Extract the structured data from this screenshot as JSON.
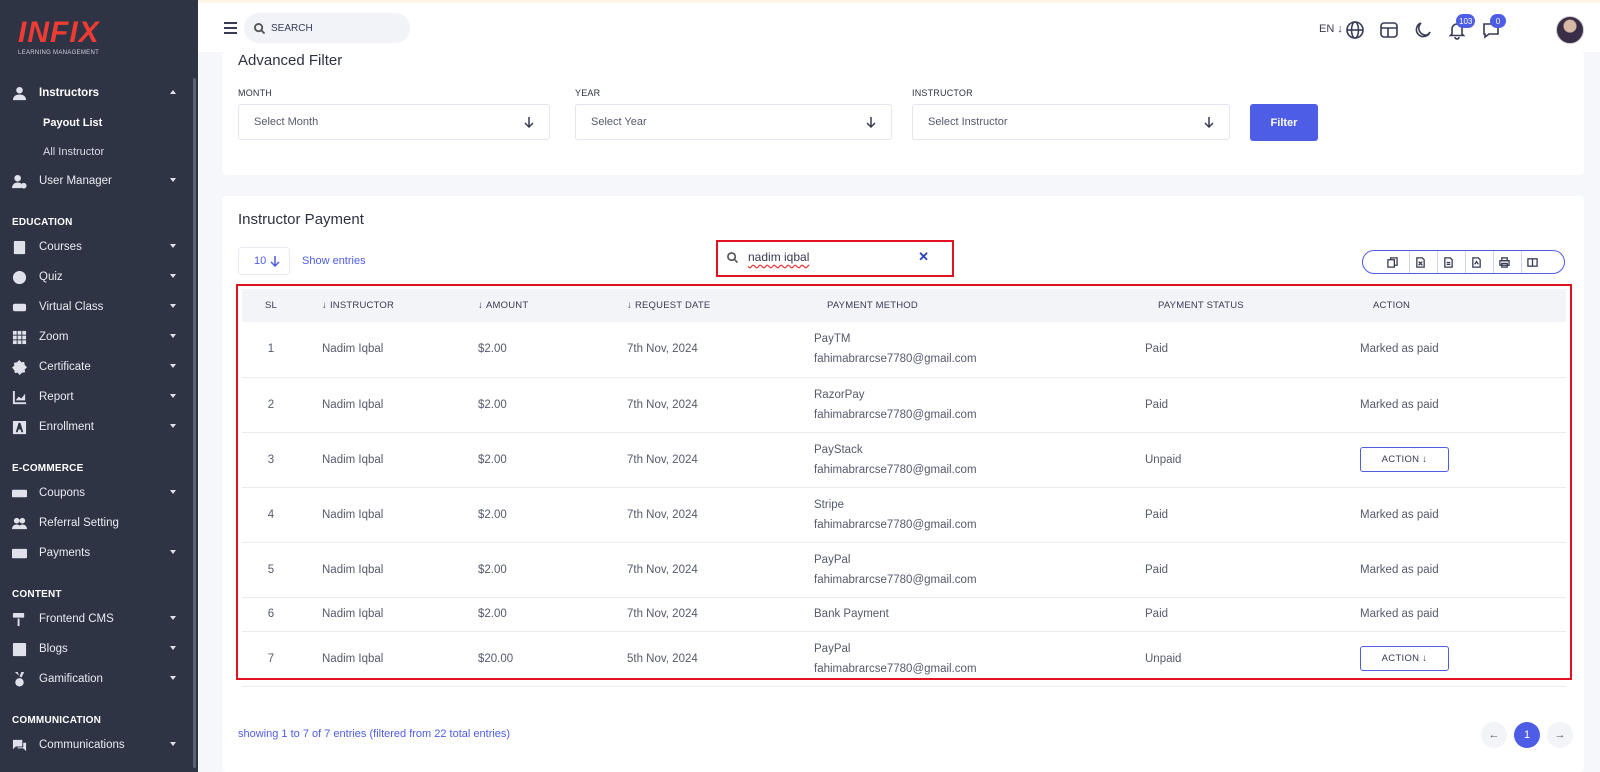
{
  "brand": {
    "logo_text": "INFIX",
    "tagline": "LEARNING MANAGEMENT"
  },
  "sidebar": {
    "instructors": {
      "label": "Instructors",
      "icon": "user-icon",
      "sub": [
        "Payout List",
        "All Instructor"
      ]
    },
    "user_manager": "User Manager",
    "sections": {
      "education": "EDUCATION",
      "ecommerce": "E-COMMERCE",
      "content": "CONTENT",
      "communication": "COMMUNICATION"
    },
    "education_items": [
      "Courses",
      "Quiz",
      "Virtual Class",
      "Zoom",
      "Certificate",
      "Report",
      "Enrollment"
    ],
    "ecommerce_items": [
      "Coupons",
      "Referral Setting",
      "Payments"
    ],
    "content_items": [
      "Frontend CMS",
      "Blogs",
      "Gamification"
    ],
    "communication_items": [
      "Communications"
    ]
  },
  "topbar": {
    "search_placeholder": "SEARCH",
    "language": "EN",
    "notifications_count": "103",
    "messages_count": "0"
  },
  "filter": {
    "title": "Advanced Filter",
    "month": {
      "label": "MONTH",
      "value": "Select Month"
    },
    "year": {
      "label": "YEAR",
      "value": "Select Year"
    },
    "instructor": {
      "label": "INSTRUCTOR",
      "value": "Select Instructor"
    },
    "button": "Filter"
  },
  "payment": {
    "title": "Instructor Payment",
    "entries_value": "10",
    "entries_label": "Show entries",
    "search_query": "nadim iqbal",
    "columns": [
      "SL",
      "INSTRUCTOR",
      "AMOUNT",
      "REQUEST DATE",
      "PAYMENT METHOD",
      "PAYMENT STATUS",
      "ACTION"
    ],
    "rows": [
      {
        "sl": "1",
        "instructor": "Nadim Iqbal",
        "amount": "$2.00",
        "date": "7th Nov, 2024",
        "method": "PayTM",
        "email": "fahimabrarcse7780@gmail.com",
        "status": "Paid",
        "action": "Marked as paid"
      },
      {
        "sl": "2",
        "instructor": "Nadim Iqbal",
        "amount": "$2.00",
        "date": "7th Nov, 2024",
        "method": "RazorPay",
        "email": "fahimabrarcse7780@gmail.com",
        "status": "Paid",
        "action": "Marked as paid"
      },
      {
        "sl": "3",
        "instructor": "Nadim Iqbal",
        "amount": "$2.00",
        "date": "7th Nov, 2024",
        "method": "PayStack",
        "email": "fahimabrarcse7780@gmail.com",
        "status": "Unpaid",
        "action": "ACTION"
      },
      {
        "sl": "4",
        "instructor": "Nadim Iqbal",
        "amount": "$2.00",
        "date": "7th Nov, 2024",
        "method": "Stripe",
        "email": "fahimabrarcse7780@gmail.com",
        "status": "Paid",
        "action": "Marked as paid"
      },
      {
        "sl": "5",
        "instructor": "Nadim Iqbal",
        "amount": "$2.00",
        "date": "7th Nov, 2024",
        "method": "PayPal",
        "email": "fahimabrarcse7780@gmail.com",
        "status": "Paid",
        "action": "Marked as paid"
      },
      {
        "sl": "6",
        "instructor": "Nadim Iqbal",
        "amount": "$2.00",
        "date": "7th Nov, 2024",
        "method": "Bank Payment",
        "email": "",
        "status": "Paid",
        "action": "Marked as paid"
      },
      {
        "sl": "7",
        "instructor": "Nadim Iqbal",
        "amount": "$20.00",
        "date": "5th Nov, 2024",
        "method": "PayPal",
        "email": "fahimabrarcse7780@gmail.com",
        "status": "Unpaid",
        "action": "ACTION"
      }
    ],
    "info": "showing 1 to 7 of 7 entries (filtered from 22 total entries)",
    "current_page": "1"
  },
  "colors": {
    "accent": "#4d5de6",
    "sidebar_bg": "#2f3445",
    "highlight": "#e0141e"
  }
}
